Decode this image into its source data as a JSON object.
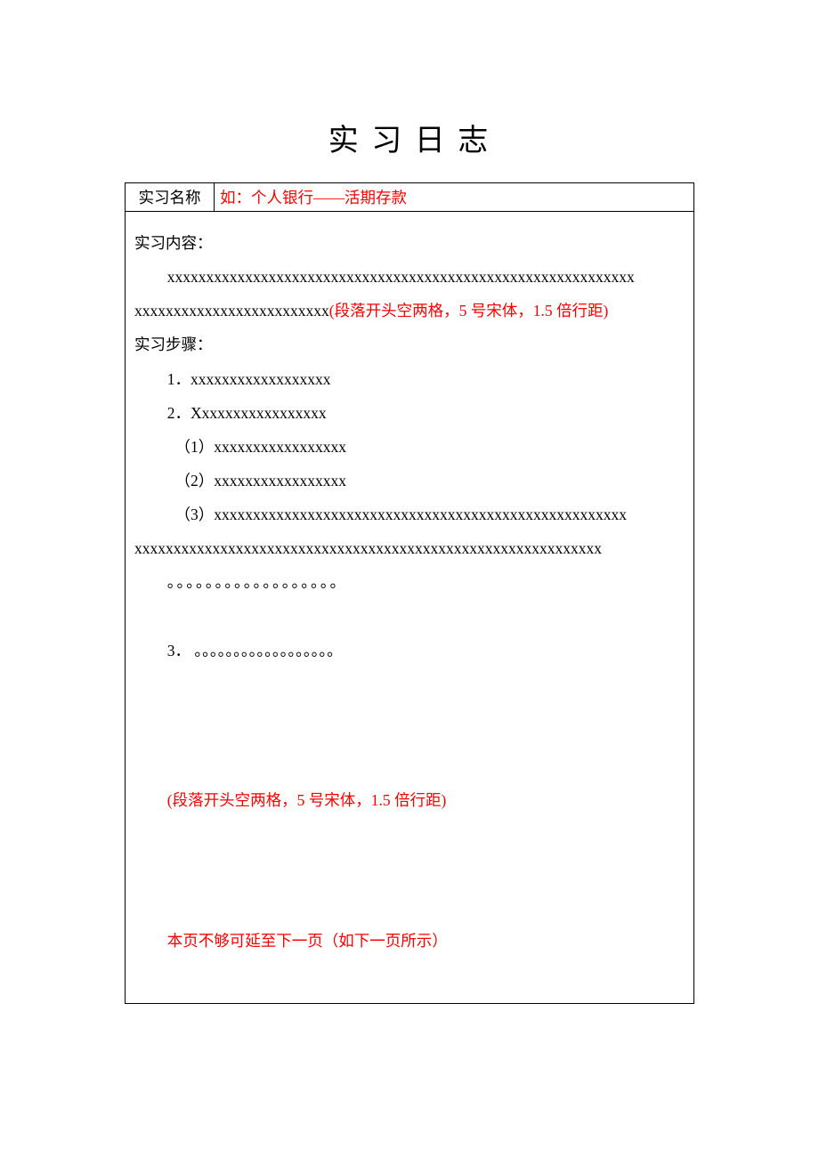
{
  "title": "实 习 日 志",
  "header_row": {
    "label": "实习名称",
    "value": "如：个人银行——活期存款"
  },
  "body": {
    "content_heading": "实习内容：",
    "content_text_line1": "xxxxxxxxxxxxxxxxxxxxxxxxxxxxxxxxxxxxxxxxxxxxxxxxxxxxxxxxxxxx",
    "content_text_line2_prefix": "xxxxxxxxxxxxxxxxxxxxxxxxx",
    "content_note": "(段落开头空两格，5 号宋体，1.5 倍行距)",
    "steps_heading": "实习步骤：",
    "step1": "1．xxxxxxxxxxxxxxxxxx",
    "step2": "2．Xxxxxxxxxxxxxxxxx",
    "sub1": "（1）xxxxxxxxxxxxxxxxx",
    "sub2": "（2）xxxxxxxxxxxxxxxxx",
    "sub3_line1": "（3）xxxxxxxxxxxxxxxxxxxxxxxxxxxxxxxxxxxxxxxxxxxxxxxxxxxxx",
    "sub3_line2": "xxxxxxxxxxxxxxxxxxxxxxxxxxxxxxxxxxxxxxxxxxxxxxxxxxxxxxxxxxxx",
    "dots1": "。。。。。。。。。。。。。。。。。。",
    "step3": "3． 。。。。。。。。。。。。。。。。。。",
    "format_note": "(段落开头空两格，5 号宋体，1.5 倍行距)",
    "footer_note": "本页不够可延至下一页（如下一页所示）"
  }
}
